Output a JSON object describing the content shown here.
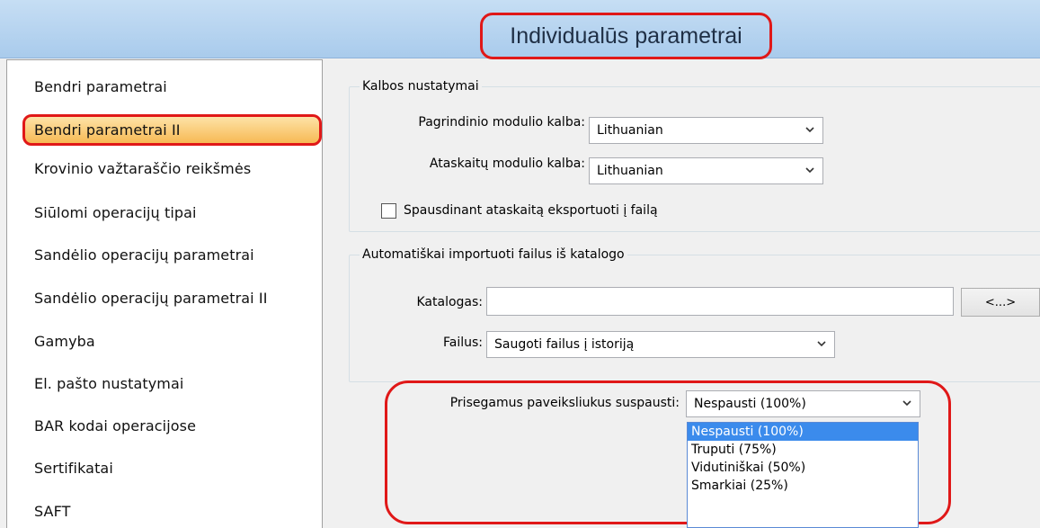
{
  "header": {
    "title": "Individualūs parametrai"
  },
  "sidebar": {
    "items": [
      {
        "label": "Bendri parametrai"
      },
      {
        "label": "Bendri parametrai II"
      },
      {
        "label": "Krovinio važtaraščio reikšmės"
      },
      {
        "label": "Siūlomi operacijų tipai"
      },
      {
        "label": "Sandėlio operacijų parametrai"
      },
      {
        "label": "Sandėlio operacijų parametrai II"
      },
      {
        "label": "Gamyba"
      },
      {
        "label": "El. pašto nustatymai"
      },
      {
        "label": "BAR kodai operacijose"
      },
      {
        "label": "Sertifikatai"
      },
      {
        "label": "SAFT"
      }
    ],
    "selected_index": 1
  },
  "language_group": {
    "title": "Kalbos nustatymai",
    "main_module_label": "Pagrindinio modulio kalba:",
    "main_module_value": "Lithuanian",
    "reports_module_label": "Ataskaitų modulio kalba:",
    "reports_module_value": "Lithuanian",
    "export_checkbox_label": "Spausdinant ataskaitą eksportuoti į failą",
    "export_checkbox_checked": false
  },
  "import_group": {
    "title": "Automatiškai importuoti failus iš katalogo",
    "catalog_label": "Katalogas:",
    "catalog_value": "",
    "browse_label": "<...>",
    "files_label": "Failus:",
    "files_value": "Saugoti failus į istoriją"
  },
  "compression": {
    "label": "Prisegamus paveiksliukus suspausti:",
    "value": "Nespausti (100%)",
    "options": [
      "Nespausti (100%)",
      "Truputi (75%)",
      "Vidutiniškai (50%)",
      "Smarkiai (25%)"
    ],
    "highlighted_option": 0
  },
  "colors": {
    "accent_red": "#e01818",
    "selection_blue": "#3b8bec",
    "selected_item_orange": "#f7b954"
  },
  "icons": {
    "chevron": "chevron-down-icon"
  }
}
